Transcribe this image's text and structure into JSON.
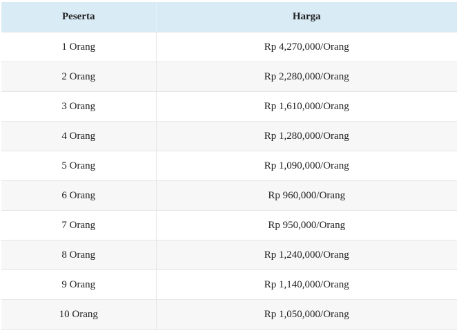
{
  "table": {
    "headers": [
      "Peserta",
      "Harga"
    ],
    "rows": [
      [
        "1 Orang",
        "Rp 4,270,000/Orang"
      ],
      [
        "2 Orang",
        "Rp 2,280,000/Orang"
      ],
      [
        "3 Orang",
        "Rp 1,610,000/Orang"
      ],
      [
        "4 Orang",
        "Rp 1,280,000/Orang"
      ],
      [
        "5 Orang",
        "Rp 1,090,000/Orang"
      ],
      [
        "6 Orang",
        "Rp 960,000/Orang"
      ],
      [
        "7 Orang",
        "Rp 950,000/Orang"
      ],
      [
        "8 Orang",
        "Rp 1,240,000/Orang"
      ],
      [
        "9 Orang",
        "Rp 1,140,000/Orang"
      ],
      [
        "10 Orang",
        "Rp 1,050,000/Orang"
      ]
    ]
  },
  "colors": {
    "header_background": "#d9ebf5",
    "row_alt_background": "#f7f7f7",
    "border": "#e6e6e6",
    "text": "#222222"
  }
}
